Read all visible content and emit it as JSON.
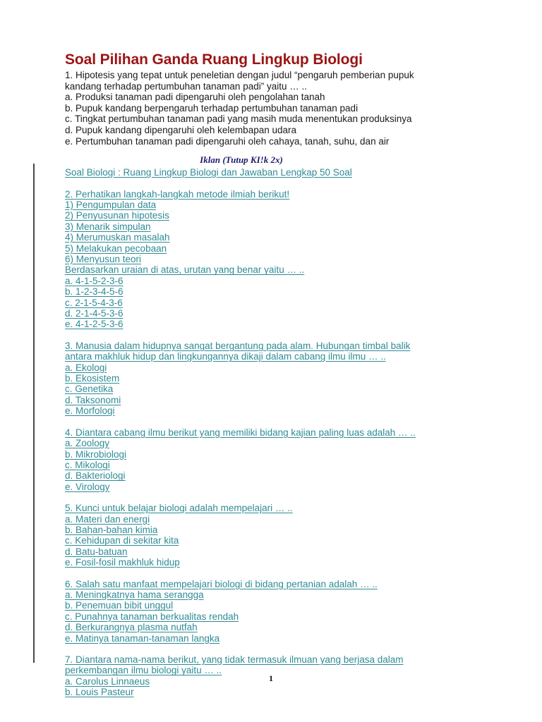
{
  "document": {
    "title": "Soal Pilihan Ganda Ruang Lingkup Biologi",
    "page_number": "1",
    "colors": {
      "title": "#9c1313",
      "link": "#2f8b95",
      "body": "#1a1a1a",
      "ad_label": "#1c1c6e",
      "margin_rule": "#4a4a4a",
      "background": "#ffffff"
    }
  },
  "question1": {
    "stem_line1": "1. Hipotesis yang tepat untuk peneletian dengan judul “pengaruh pemberian pupuk",
    "stem_line2": "kandang terhadap pertumbuhan tanaman padi” yaitu … ..",
    "options": [
      "a. Produksi tanaman padi dipengaruhi oleh pengolahan tanah",
      "b. Pupuk kandang berpengaruh terhadap pertumbuhan tanaman padi",
      "c. Tingkat pertumbuhan tanaman padi yang masih muda menentukan produksinya",
      "d. Pupuk kandang dipengaruhi oleh kelembapan udara",
      "e. Pertumbuhan tanaman padi dipengaruhi oleh cahaya, tanah, suhu, dan air"
    ]
  },
  "ad": {
    "label": "Iklan (Tutup KI!k 2x)",
    "link": "Soal Biologi : Ruang Lingkup Biologi dan Jawaban Lengkap 50 Soal"
  },
  "question2": {
    "stem": "2. Perhatikan langkah-langkah metode ilmiah berikut!",
    "steps": [
      "1) Pengumpulan data",
      "2) Penyusunan hipotesis",
      "3) Menarik simpulan",
      "4) Merumuskan masalah",
      "5) Melakukan pecobaan",
      "6) Menyusun teori"
    ],
    "instruction": "Berdasarkan uraian di atas, urutan yang benar yaitu … ..",
    "options": [
      "a. 4-1-5-2-3-6",
      "b. 1-2-3-4-5-6",
      "c. 2-1-5-4-3-6",
      "d. 2-1-4-5-3-6",
      "e. 4-1-2-5-3-6"
    ]
  },
  "question3": {
    "stem_line1": "3. Manusia dalam hidupnya sangat bergantung pada alam. Hubungan timbal balik",
    "stem_line2": "antara makhluk hidup dan lingkungannya dikaji dalam cabang ilmu ilmu … ..",
    "options": [
      "a. Ekologi",
      "b. Ekosistem",
      "c. Genetika",
      "d. Taksonomi",
      "e. Morfologi"
    ]
  },
  "question4": {
    "stem": "4. Diantara cabang ilmu berikut yang memiliki bidang kajian paling luas adalah … ..",
    "options": [
      "a. Zoology",
      "b. Mikrobiologi",
      "c. Mikologi",
      "d. Bakteriologi",
      "e. Virology"
    ]
  },
  "question5": {
    "stem": "5. Kunci untuk belajar biologi adalah mempelajari … ..",
    "options": [
      "a. Materi dan energi",
      "b. Bahan-bahan kimia",
      "c. Kehidupan di sekitar kita",
      "d. Batu-batuan",
      "e. Fosil-fosil makhluk hidup"
    ]
  },
  "question6": {
    "stem": "6. Salah satu manfaat mempelajari biologi di bidang pertanian adalah … ..",
    "options": [
      "a. Meningkatnya hama serangga",
      "b. Penemuan bibit unggul",
      "c. Punahnya tanaman berkualitas rendah",
      "d. Berkurangnya plasma nutfah",
      "e. Matinya tanaman-tanaman langka"
    ]
  },
  "question7": {
    "stem_line1": "7. Diantara nama-nama berikut, yang tidak termasuk ilmuan yang berjasa dalam",
    "stem_line2": "perkembangan ilmu biologi yaitu … ..",
    "options": [
      "a. Carolus Linnaeus",
      "b. Louis Pasteur"
    ]
  }
}
